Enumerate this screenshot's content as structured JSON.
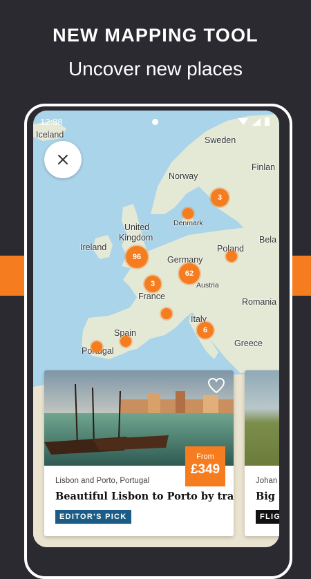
{
  "promo": {
    "headline": "NEW MAPPING TOOL",
    "subline": "Uncover new places"
  },
  "statusbar": {
    "time": "12:38"
  },
  "map": {
    "labels": [
      {
        "id": "iceland",
        "text": "Iceland"
      },
      {
        "id": "sweden",
        "text": "Sweden"
      },
      {
        "id": "finland",
        "text": "Finlan"
      },
      {
        "id": "norway",
        "text": "Norway"
      },
      {
        "id": "denmark",
        "text": "Denmark"
      },
      {
        "id": "uk1",
        "text": "United"
      },
      {
        "id": "uk2",
        "text": "Kingdom"
      },
      {
        "id": "ireland",
        "text": "Ireland"
      },
      {
        "id": "poland",
        "text": "Poland"
      },
      {
        "id": "belarus",
        "text": "Bela"
      },
      {
        "id": "germany",
        "text": "Germany"
      },
      {
        "id": "austria",
        "text": "Austria"
      },
      {
        "id": "france",
        "text": "France"
      },
      {
        "id": "romania",
        "text": "Romania"
      },
      {
        "id": "italy",
        "text": "Italy"
      },
      {
        "id": "spain",
        "text": "Spain"
      },
      {
        "id": "portugal",
        "text": "Portugal"
      },
      {
        "id": "greece",
        "text": "Greece"
      }
    ],
    "markers": [
      {
        "id": "sweden",
        "count": "3"
      },
      {
        "id": "denmark",
        "count": ""
      },
      {
        "id": "uk",
        "count": "96"
      },
      {
        "id": "germany",
        "count": "62"
      },
      {
        "id": "poland",
        "count": ""
      },
      {
        "id": "france",
        "count": "3"
      },
      {
        "id": "southfrance",
        "count": ""
      },
      {
        "id": "italy",
        "count": "6"
      },
      {
        "id": "spain",
        "count": ""
      },
      {
        "id": "portugal",
        "count": ""
      }
    ]
  },
  "cards": [
    {
      "location": "Lisbon and Porto, Portugal",
      "title": "Beautiful Lisbon to Porto by train",
      "badge": "EDITOR'S PICK",
      "price_from": "From",
      "price": "£349"
    },
    {
      "location": "Johan",
      "title": "Big F",
      "badge": "FLIGH"
    }
  ],
  "colors": {
    "background": "#2b2a31",
    "accent": "#f57c1f",
    "badge_blue": "#1b5d86",
    "sea": "#a9d4ea",
    "land": "#e4e9d5"
  }
}
